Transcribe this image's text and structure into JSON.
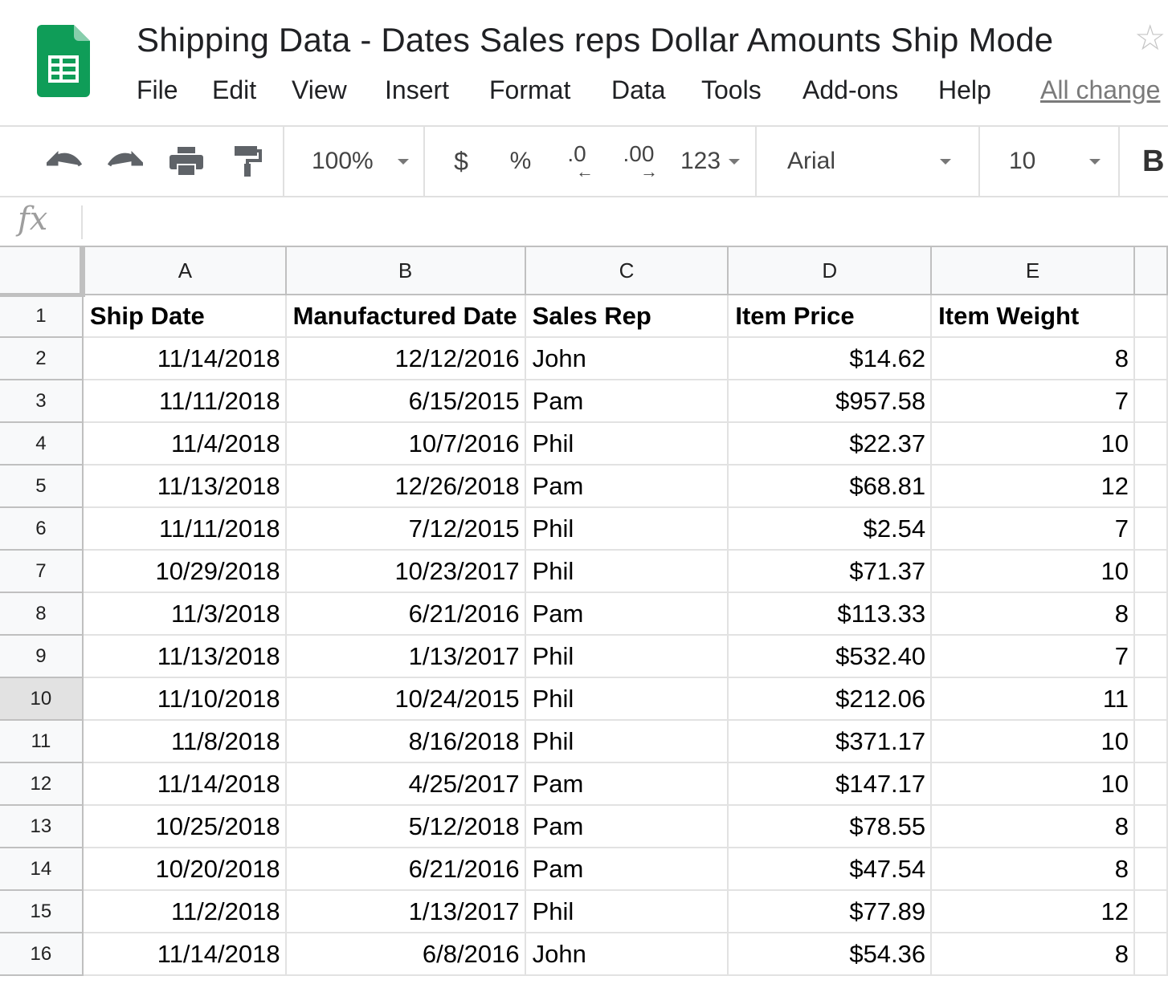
{
  "document": {
    "title": "Shipping Data - Dates Sales reps Dollar Amounts Ship Mode"
  },
  "menu": [
    "File",
    "Edit",
    "View",
    "Insert",
    "Format",
    "Data",
    "Tools",
    "Add-ons",
    "Help"
  ],
  "all_changes_link": "All change",
  "toolbar": {
    "zoom": "100%",
    "currency": "$",
    "percent": "%",
    "decrease_decimal": ".0",
    "increase_decimal": ".00",
    "more_formats": "123",
    "font": "Arial",
    "font_size": "10",
    "bold": "B"
  },
  "formula_bar": {
    "icon": "fx",
    "value": ""
  },
  "columns": [
    "A",
    "B",
    "C",
    "D",
    "E"
  ],
  "rows": [
    {
      "n": "1",
      "a": "Ship Date",
      "b": "Manufactured Date",
      "c": "Sales Rep",
      "d": "Item Price",
      "e": "Item Weight"
    },
    {
      "n": "2",
      "a": "11/14/2018",
      "b": "12/12/2016",
      "c": "John",
      "d": "$14.62",
      "e": "8"
    },
    {
      "n": "3",
      "a": "11/11/2018",
      "b": "6/15/2015",
      "c": "Pam",
      "d": "$957.58",
      "e": "7"
    },
    {
      "n": "4",
      "a": "11/4/2018",
      "b": "10/7/2016",
      "c": "Phil",
      "d": "$22.37",
      "e": "10"
    },
    {
      "n": "5",
      "a": "11/13/2018",
      "b": "12/26/2018",
      "c": "Pam",
      "d": "$68.81",
      "e": "12"
    },
    {
      "n": "6",
      "a": "11/11/2018",
      "b": "7/12/2015",
      "c": "Phil",
      "d": "$2.54",
      "e": "7"
    },
    {
      "n": "7",
      "a": "10/29/2018",
      "b": "10/23/2017",
      "c": "Phil",
      "d": "$71.37",
      "e": "10"
    },
    {
      "n": "8",
      "a": "11/3/2018",
      "b": "6/21/2016",
      "c": "Pam",
      "d": "$113.33",
      "e": "8"
    },
    {
      "n": "9",
      "a": "11/13/2018",
      "b": "1/13/2017",
      "c": "Phil",
      "d": "$532.40",
      "e": "7"
    },
    {
      "n": "10",
      "a": "11/10/2018",
      "b": "10/24/2015",
      "c": "Phil",
      "d": "$212.06",
      "e": "11"
    },
    {
      "n": "11",
      "a": "11/8/2018",
      "b": "8/16/2018",
      "c": "Phil",
      "d": "$371.17",
      "e": "10"
    },
    {
      "n": "12",
      "a": "11/14/2018",
      "b": "4/25/2017",
      "c": "Pam",
      "d": "$147.17",
      "e": "10"
    },
    {
      "n": "13",
      "a": "10/25/2018",
      "b": "5/12/2018",
      "c": "Pam",
      "d": "$78.55",
      "e": "8"
    },
    {
      "n": "14",
      "a": "10/20/2018",
      "b": "6/21/2016",
      "c": "Pam",
      "d": "$47.54",
      "e": "8"
    },
    {
      "n": "15",
      "a": "11/2/2018",
      "b": "1/13/2017",
      "c": "Phil",
      "d": "$77.89",
      "e": "12"
    },
    {
      "n": "16",
      "a": "11/14/2018",
      "b": "6/8/2016",
      "c": "John",
      "d": "$54.36",
      "e": "8"
    }
  ],
  "selected_row": "10",
  "colors": {
    "sheets_green": "#0f9d58",
    "header_bg": "#f8f9fa",
    "grid_line": "#e2e2e2"
  }
}
